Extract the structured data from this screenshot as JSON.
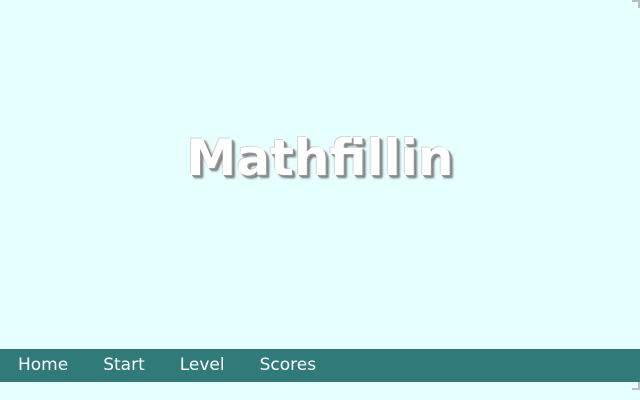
{
  "game": {
    "title": "Mathfillin"
  },
  "nav": {
    "items": [
      {
        "label": "Home"
      },
      {
        "label": "Start"
      },
      {
        "label": "Level"
      },
      {
        "label": "Scores"
      }
    ]
  },
  "colors": {
    "background": "#e6ffff",
    "nav_bar": "#317a7a",
    "nav_text": "#ffffff",
    "title_text": "#ffffff"
  }
}
